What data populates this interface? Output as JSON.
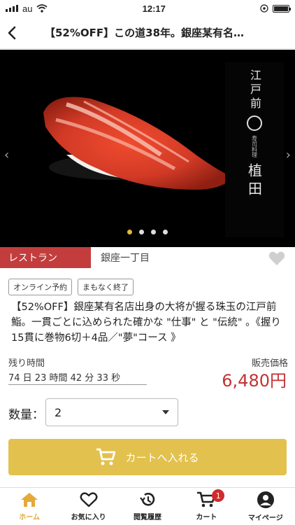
{
  "status_bar": {
    "carrier": "au",
    "time": "12:17"
  },
  "nav": {
    "title": "【52%OFF】この道38年。銀座某有名…"
  },
  "hero": {
    "sign_text_top": "江戸前",
    "sign_text_small": "寿司料理",
    "sign_text_bottom": "植田",
    "slide_count": 4,
    "active_slide": 1
  },
  "item": {
    "category": "レストラン",
    "location": "銀座一丁目",
    "badges": [
      "オンライン予約",
      "まもなく終了"
    ],
    "description": "【52%OFF】銀座某有名店出身の大将が握る珠玉の江戸前鮨。一貫ごとに込められた確かな \"仕事\" と \"伝統\" 。《握り15貫に巻物6切＋4品／\"夢\"コース 》",
    "time_left_label": "残り時間",
    "time_left_value": "74 日 23 時間 42 分 33 秒",
    "price_label": "販売価格",
    "price": "6,480円"
  },
  "purchase": {
    "quantity_label": "数量：",
    "quantity_value": "2",
    "cart_button_label": "カートへ入れる"
  },
  "tabbar": {
    "items": [
      {
        "label": "ホーム",
        "icon": "home-icon"
      },
      {
        "label": "お気に入り",
        "icon": "heart-icon"
      },
      {
        "label": "閲覧履歴",
        "icon": "history-icon"
      },
      {
        "label": "カート",
        "icon": "cart-icon",
        "badge": "1"
      },
      {
        "label": "マイページ",
        "icon": "user-icon"
      }
    ]
  },
  "colors": {
    "accent": "#e2c14e",
    "category_red": "#c33d3d",
    "price_red": "#c23333",
    "active_tab": "#e2a93b"
  }
}
